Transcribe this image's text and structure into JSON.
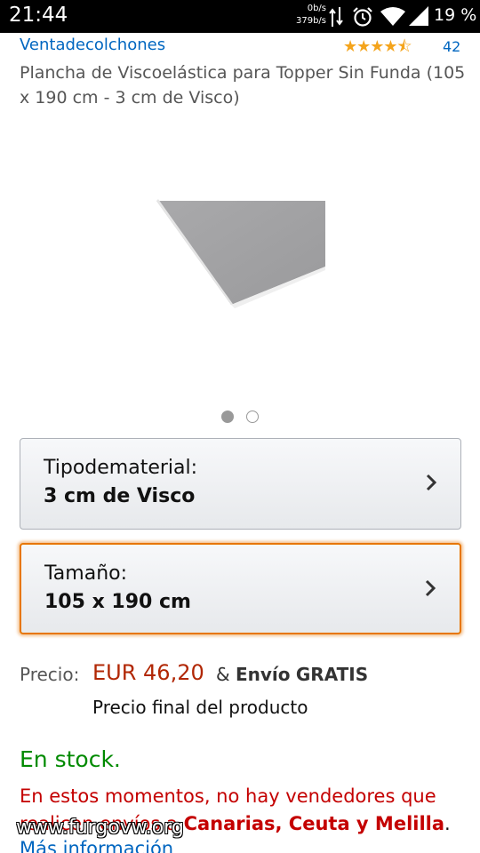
{
  "status_bar": {
    "time": "21:44",
    "net_up": "0b/s",
    "net_down": "379b/s",
    "battery": "19 %"
  },
  "product": {
    "brand": "Ventadecolchones",
    "stars": "★★★★⯪",
    "rating_count": "42",
    "title": "Plancha de Viscoelástica para Topper Sin Funda (105 x 190 cm - 3 cm de Visco)"
  },
  "gallery": {
    "active_index": 1,
    "total": 2
  },
  "variations": {
    "material": {
      "label": "Tipodematerial:",
      "value": "3 cm de Visco"
    },
    "size": {
      "label": "Tamaño:",
      "value": "105 x 190 cm"
    }
  },
  "price": {
    "label": "Precio:",
    "amount": "EUR 46,20",
    "ampersand": "&",
    "shipping_word": "Envío",
    "shipping_free": "GRATIS",
    "note": "Precio final del producto"
  },
  "availability": {
    "stock": "En stock.",
    "warning_prefix": "En estos momentos, no hay vendedores que realicen envíos a",
    "warning_regions": "Canarias, Ceuta y Melilla",
    "warning_end": ".",
    "more_info": "Más información"
  },
  "watermark": "www.furgovw.org",
  "colors": {
    "link": "#0066c0",
    "price": "#b12704",
    "stock": "#008a00",
    "warning": "#c40000",
    "selected_border": "#e77600"
  }
}
